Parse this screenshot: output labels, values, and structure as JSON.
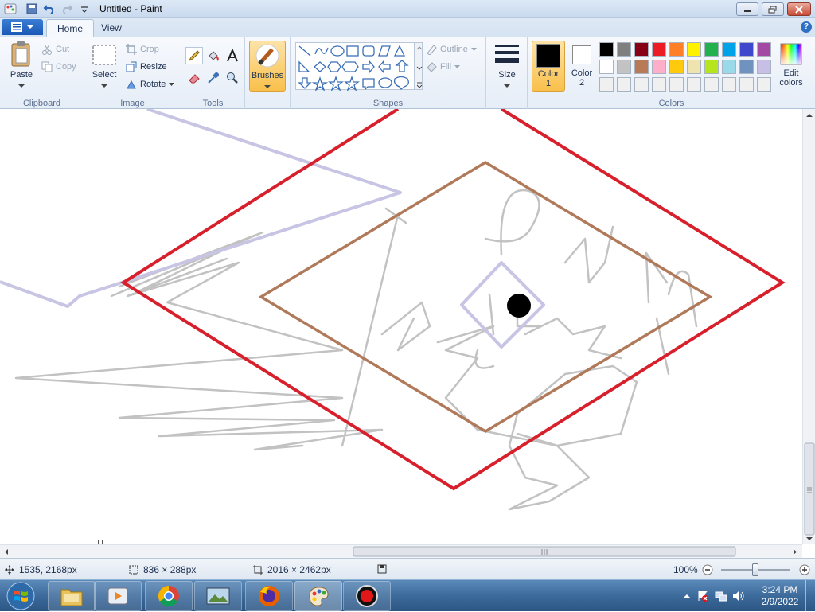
{
  "window": {
    "title": "Untitled - Paint"
  },
  "tabs": [
    {
      "label": "Home"
    },
    {
      "label": "View"
    }
  ],
  "help_label": "?",
  "ribbon": {
    "clipboard": {
      "label": "Clipboard",
      "paste": "Paste",
      "cut": "Cut",
      "copy": "Copy"
    },
    "image": {
      "label": "Image",
      "select": "Select",
      "crop": "Crop",
      "resize": "Resize",
      "rotate": "Rotate"
    },
    "tools": {
      "label": "Tools"
    },
    "brushes": {
      "label": "Brushes"
    },
    "shapes": {
      "label": "Shapes",
      "outline": "Outline",
      "fill": "Fill"
    },
    "size": {
      "label": "Size"
    },
    "colors": {
      "label": "Colors",
      "color1_label": "Color",
      "color1_num": "1",
      "color1_value": "#000000",
      "color2_label": "Color",
      "color2_num": "2",
      "color2_value": "#ffffff",
      "edit_label": "Edit",
      "edit_label2": "colors",
      "palette_row1": [
        "#000000",
        "#7f7f7f",
        "#880015",
        "#ed1c24",
        "#ff7f27",
        "#fff200",
        "#22b14c",
        "#00a2e8",
        "#3f48cc",
        "#a349a4"
      ],
      "palette_row2": [
        "#ffffff",
        "#c3c3c3",
        "#b97a57",
        "#ffaec9",
        "#ffc90e",
        "#efe4b0",
        "#b5e61d",
        "#99d9ea",
        "#7092be",
        "#c8bfe7"
      ],
      "palette_row3": [
        "#f0f0f0",
        "#f0f0f0",
        "#f0f0f0",
        "#f0f0f0",
        "#f0f0f0",
        "#f0f0f0",
        "#f0f0f0",
        "#f0f0f0",
        "#f0f0f0",
        "#f0f0f0"
      ]
    }
  },
  "status": {
    "cursor_pos": "1535, 2168px",
    "selection_size": "836 × 288px",
    "image_size": "2016 × 2462px",
    "zoom": "100%",
    "zoom_slider_value": 0.5
  },
  "taskbar": {
    "time": "3:24 PM",
    "date": "2/9/2022",
    "apps": [
      {
        "icon": "windows-explorer-icon"
      },
      {
        "icon": "media-player-icon"
      },
      {
        "icon": "chrome-icon"
      },
      {
        "icon": "photo-viewer-icon"
      },
      {
        "icon": "firefox-icon"
      },
      {
        "icon": "paint-icon"
      },
      {
        "icon": "record-icon"
      }
    ]
  },
  "colors": {
    "red": "#d7202b",
    "brown": "#b07a5a",
    "lavender": "#c8c4e4",
    "gray": "#c2c2c2"
  }
}
